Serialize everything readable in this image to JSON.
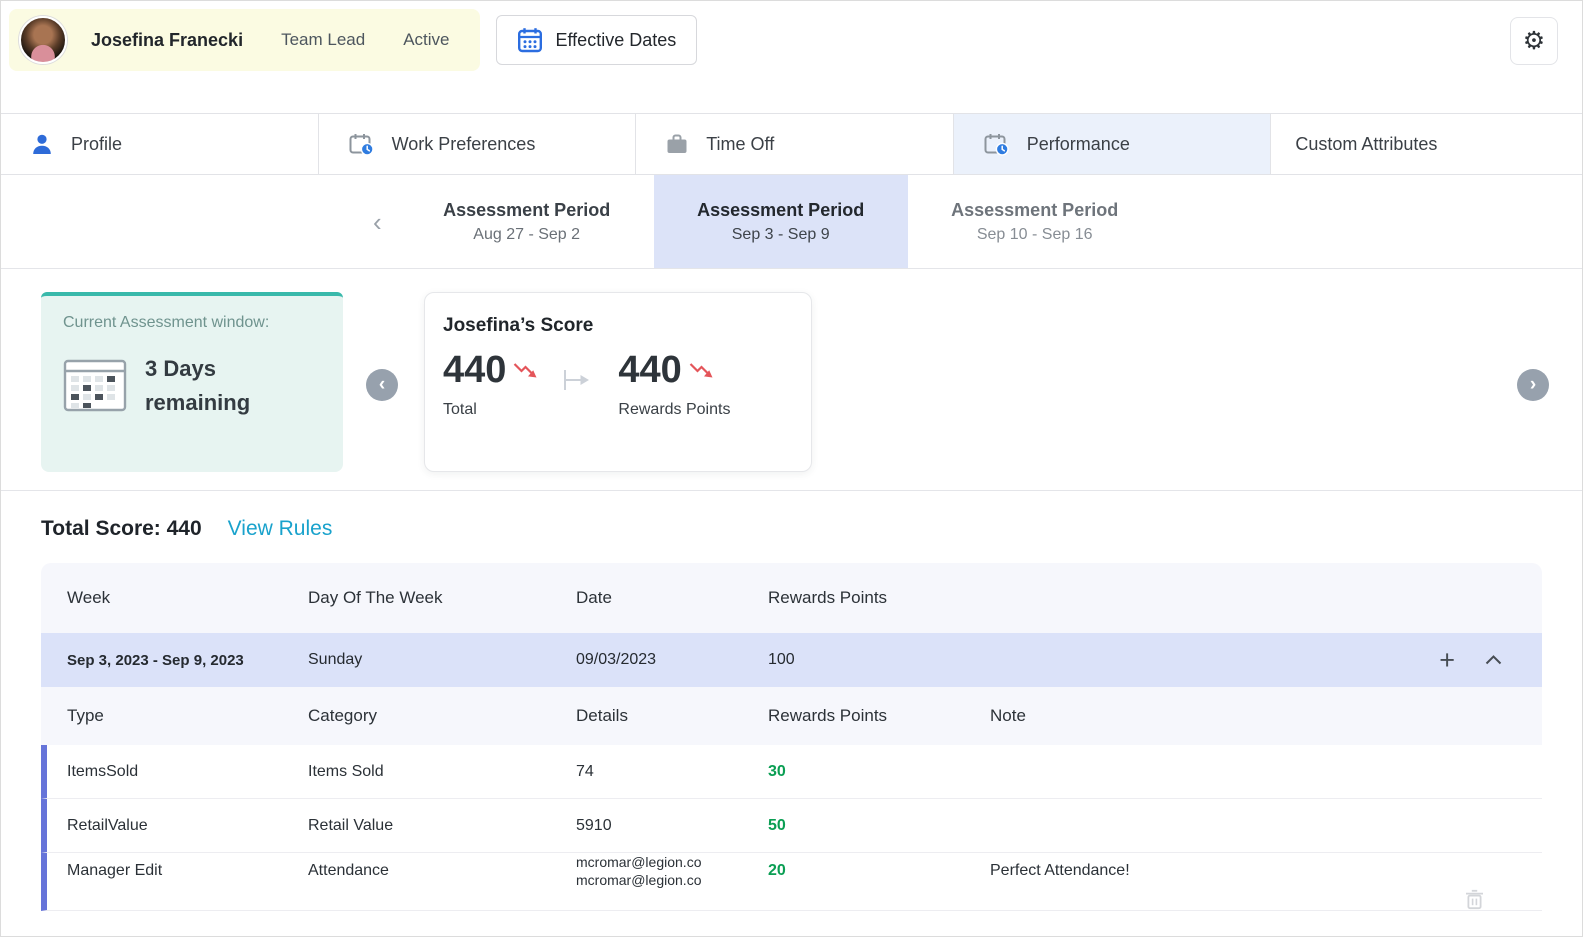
{
  "colors": {
    "accent_blue": "#2e6bd8",
    "teal": "#39b9ab",
    "link_blue": "#19a2cc",
    "green": "#0a9e53",
    "red": "#e4555a",
    "purple_bar": "#6674d9",
    "selected_period_bg": "#dce3f8",
    "employee_card_bg": "#fbfbe2"
  },
  "header": {
    "name": "Josefina Franecki",
    "role": "Team Lead",
    "status": "Active",
    "effective_dates": "Effective Dates"
  },
  "tabs": [
    {
      "label": "Profile"
    },
    {
      "label": "Work Preferences"
    },
    {
      "label": "Time Off"
    },
    {
      "label": "Performance"
    },
    {
      "label": "Custom Attributes"
    }
  ],
  "periods": [
    {
      "title": "Assessment Period",
      "range": "Aug 27 - Sep 2"
    },
    {
      "title": "Assessment Period",
      "range": "Sep 3 - Sep 9"
    },
    {
      "title": "Assessment Period",
      "range": "Sep 10 - Sep 16"
    }
  ],
  "window_card": {
    "label": "Current Assessment window:",
    "remaining": "3 Days remaining"
  },
  "score_card": {
    "title": "Josefina’s Score",
    "total_value": "440",
    "total_label": "Total",
    "rewards_value": "440",
    "rewards_label": "Rewards Points"
  },
  "summary": {
    "total_score": "Total Score: 440",
    "view_rules": "View Rules"
  },
  "table": {
    "headers": [
      "Week",
      "Day Of The Week",
      "Date",
      "Rewards Points"
    ],
    "week_row": {
      "week": "Sep 3, 2023 - Sep 9, 2023",
      "day": "Sunday",
      "date": "09/03/2023",
      "points": "100"
    },
    "detail_headers": [
      "Type",
      "Category",
      "Details",
      "Rewards Points",
      "Note"
    ],
    "detail_rows": [
      {
        "type": "ItemsSold",
        "category": "Items Sold",
        "details": "74",
        "points": "30",
        "note": ""
      },
      {
        "type": "RetailValue",
        "category": "Retail Value",
        "details": "5910",
        "points": "50",
        "note": ""
      },
      {
        "type": "Manager Edit",
        "category": "Attendance",
        "details": "mcromar@legion.co\nmcromar@legion.co",
        "points": "20",
        "note": "Perfect Attendance!"
      }
    ]
  }
}
